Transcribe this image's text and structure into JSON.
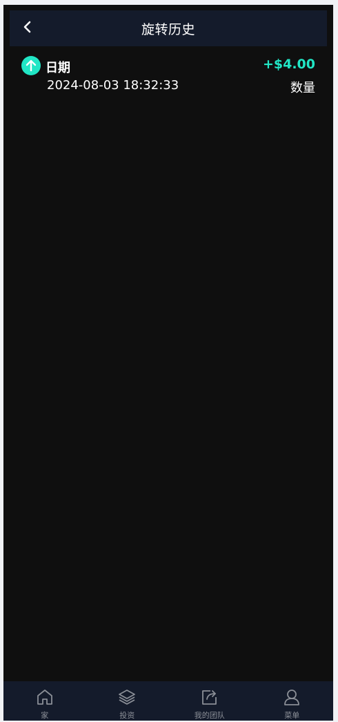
{
  "header": {
    "title": "旋转历史",
    "back_icon": "chevron-left-icon"
  },
  "records": [
    {
      "icon": "arrow-up-icon",
      "label": "日期",
      "date": "2024-08-03 18:32:33",
      "amount": "+$4.00",
      "amount_label": "数量"
    }
  ],
  "tabbar": {
    "items": [
      {
        "label": "家",
        "icon": "home-icon"
      },
      {
        "label": "投资",
        "icon": "layers-icon"
      },
      {
        "label": "我的团队",
        "icon": "share-icon"
      },
      {
        "label": "菜单",
        "icon": "user-icon"
      }
    ]
  },
  "colors": {
    "page_background": "#0f0f0f",
    "header_background": "#141b2b",
    "accent": "#21e6c5",
    "tab_label": "#8b8f97"
  }
}
